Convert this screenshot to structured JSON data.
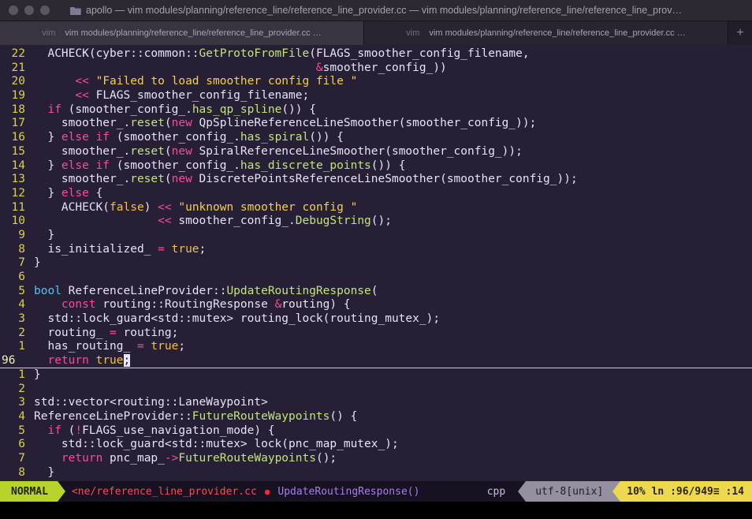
{
  "window": {
    "title": "apollo — vim modules/planning/reference_line/reference_line_provider.cc — vim modules/planning/reference_line/reference_line_prov…",
    "tabs": [
      {
        "process": "vim",
        "title": "vim modules/planning/reference_line/reference_line_provider.cc …"
      },
      {
        "process": "vim",
        "title": "vim modules/planning/reference_line/reference_line_provider.cc …"
      }
    ],
    "new_tab_label": "+"
  },
  "editor": {
    "lines": [
      {
        "num": "22",
        "current": false,
        "tokens": [
          {
            "c": "d",
            "t": "  ACHECK("
          },
          {
            "c": "d",
            "t": "cyber::common::"
          },
          {
            "c": "f",
            "t": "GetProtoFromFile"
          },
          {
            "c": "d",
            "t": "(FLAGS_smoother_config_filename,"
          }
        ]
      },
      {
        "num": "21",
        "current": false,
        "tokens": [
          {
            "c": "d",
            "t": "                                         "
          },
          {
            "c": "k",
            "t": "&"
          },
          {
            "c": "d",
            "t": "smoother_config_))"
          }
        ]
      },
      {
        "num": "20",
        "current": false,
        "tokens": [
          {
            "c": "d",
            "t": "      "
          },
          {
            "c": "k",
            "t": "<<"
          },
          {
            "c": "d",
            "t": " "
          },
          {
            "c": "s",
            "t": "\"Failed to load smoother config file \""
          }
        ]
      },
      {
        "num": "19",
        "current": false,
        "tokens": [
          {
            "c": "d",
            "t": "      "
          },
          {
            "c": "k",
            "t": "<<"
          },
          {
            "c": "d",
            "t": " FLAGS_smoother_config_filename;"
          }
        ]
      },
      {
        "num": "18",
        "current": false,
        "tokens": [
          {
            "c": "d",
            "t": "  "
          },
          {
            "c": "k",
            "t": "if"
          },
          {
            "c": "d",
            "t": " (smoother_config_."
          },
          {
            "c": "f",
            "t": "has_qp_spline"
          },
          {
            "c": "d",
            "t": "()) {"
          }
        ]
      },
      {
        "num": "17",
        "current": false,
        "tokens": [
          {
            "c": "d",
            "t": "    smoother_."
          },
          {
            "c": "f",
            "t": "reset"
          },
          {
            "c": "d",
            "t": "("
          },
          {
            "c": "k",
            "t": "new"
          },
          {
            "c": "d",
            "t": " QpSplineReferenceLineSmoother(smoother_config_));"
          }
        ]
      },
      {
        "num": "16",
        "current": false,
        "tokens": [
          {
            "c": "d",
            "t": "  } "
          },
          {
            "c": "k",
            "t": "else"
          },
          {
            "c": "d",
            "t": " "
          },
          {
            "c": "k",
            "t": "if"
          },
          {
            "c": "d",
            "t": " (smoother_config_."
          },
          {
            "c": "f",
            "t": "has_spiral"
          },
          {
            "c": "d",
            "t": "()) {"
          }
        ]
      },
      {
        "num": "15",
        "current": false,
        "tokens": [
          {
            "c": "d",
            "t": "    smoother_."
          },
          {
            "c": "f",
            "t": "reset"
          },
          {
            "c": "d",
            "t": "("
          },
          {
            "c": "k",
            "t": "new"
          },
          {
            "c": "d",
            "t": " SpiralReferenceLineSmoother(smoother_config_));"
          }
        ]
      },
      {
        "num": "14",
        "current": false,
        "tokens": [
          {
            "c": "d",
            "t": "  } "
          },
          {
            "c": "k",
            "t": "else"
          },
          {
            "c": "d",
            "t": " "
          },
          {
            "c": "k",
            "t": "if"
          },
          {
            "c": "d",
            "t": " (smoother_config_."
          },
          {
            "c": "f",
            "t": "has_discrete_points"
          },
          {
            "c": "d",
            "t": "()) {"
          }
        ]
      },
      {
        "num": "13",
        "current": false,
        "tokens": [
          {
            "c": "d",
            "t": "    smoother_."
          },
          {
            "c": "f",
            "t": "reset"
          },
          {
            "c": "d",
            "t": "("
          },
          {
            "c": "k",
            "t": "new"
          },
          {
            "c": "d",
            "t": " DiscretePointsReferenceLineSmoother(smoother_config_));"
          }
        ]
      },
      {
        "num": "12",
        "current": false,
        "tokens": [
          {
            "c": "d",
            "t": "  } "
          },
          {
            "c": "k",
            "t": "else"
          },
          {
            "c": "d",
            "t": " {"
          }
        ]
      },
      {
        "num": "11",
        "current": false,
        "tokens": [
          {
            "c": "d",
            "t": "    ACHECK("
          },
          {
            "c": "b",
            "t": "false"
          },
          {
            "c": "d",
            "t": ") "
          },
          {
            "c": "k",
            "t": "<<"
          },
          {
            "c": "d",
            "t": " "
          },
          {
            "c": "s",
            "t": "\"unknown smoother config \""
          }
        ]
      },
      {
        "num": "10",
        "current": false,
        "tokens": [
          {
            "c": "d",
            "t": "                  "
          },
          {
            "c": "k",
            "t": "<<"
          },
          {
            "c": "d",
            "t": " smoother_config_."
          },
          {
            "c": "f",
            "t": "DebugString"
          },
          {
            "c": "d",
            "t": "();"
          }
        ]
      },
      {
        "num": "9",
        "current": false,
        "tokens": [
          {
            "c": "d",
            "t": "  }"
          }
        ]
      },
      {
        "num": "8",
        "current": false,
        "tokens": [
          {
            "c": "d",
            "t": "  is_initialized_ "
          },
          {
            "c": "k",
            "t": "="
          },
          {
            "c": "d",
            "t": " "
          },
          {
            "c": "b",
            "t": "true"
          },
          {
            "c": "d",
            "t": ";"
          }
        ]
      },
      {
        "num": "7",
        "current": false,
        "tokens": [
          {
            "c": "d",
            "t": "}"
          }
        ]
      },
      {
        "num": "6",
        "current": false,
        "tokens": []
      },
      {
        "num": "5",
        "current": false,
        "tokens": [
          {
            "c": "t",
            "t": "bool"
          },
          {
            "c": "d",
            "t": " ReferenceLineProvider::"
          },
          {
            "c": "f",
            "t": "UpdateRoutingResponse"
          },
          {
            "c": "d",
            "t": "("
          }
        ]
      },
      {
        "num": "4",
        "current": false,
        "tokens": [
          {
            "c": "d",
            "t": "    "
          },
          {
            "c": "k",
            "t": "const"
          },
          {
            "c": "d",
            "t": " routing::RoutingResponse "
          },
          {
            "c": "k",
            "t": "&"
          },
          {
            "c": "d",
            "t": "routing) {"
          }
        ]
      },
      {
        "num": "3",
        "current": false,
        "tokens": [
          {
            "c": "d",
            "t": "  std::lock_guard<std::mutex> routing_lock(routing_mutex_);"
          }
        ]
      },
      {
        "num": "2",
        "current": false,
        "tokens": [
          {
            "c": "d",
            "t": "  routing_ "
          },
          {
            "c": "k",
            "t": "="
          },
          {
            "c": "d",
            "t": " routing;"
          }
        ]
      },
      {
        "num": "1",
        "current": false,
        "tokens": [
          {
            "c": "d",
            "t": "  has_routing_ "
          },
          {
            "c": "k",
            "t": "="
          },
          {
            "c": "d",
            "t": " "
          },
          {
            "c": "b",
            "t": "true"
          },
          {
            "c": "d",
            "t": ";"
          }
        ]
      },
      {
        "num": "96",
        "current": true,
        "tokens": [
          {
            "c": "d",
            "t": "  "
          },
          {
            "c": "k",
            "t": "return"
          },
          {
            "c": "d",
            "t": " "
          },
          {
            "c": "b",
            "t": "true"
          },
          {
            "c": "c",
            "t": ";"
          }
        ]
      },
      {
        "num": "1",
        "current": false,
        "tokens": [
          {
            "c": "d",
            "t": "}"
          }
        ]
      },
      {
        "num": "2",
        "current": false,
        "tokens": []
      },
      {
        "num": "3",
        "current": false,
        "tokens": [
          {
            "c": "d",
            "t": "std::vector<routing::LaneWaypoint>"
          }
        ]
      },
      {
        "num": "4",
        "current": false,
        "tokens": [
          {
            "c": "d",
            "t": "ReferenceLineProvider::"
          },
          {
            "c": "f",
            "t": "FutureRouteWaypoints"
          },
          {
            "c": "d",
            "t": "() {"
          }
        ]
      },
      {
        "num": "5",
        "current": false,
        "tokens": [
          {
            "c": "d",
            "t": "  "
          },
          {
            "c": "k",
            "t": "if"
          },
          {
            "c": "d",
            "t": " ("
          },
          {
            "c": "k",
            "t": "!"
          },
          {
            "c": "d",
            "t": "FLAGS_use_navigation_mode) {"
          }
        ]
      },
      {
        "num": "6",
        "current": false,
        "tokens": [
          {
            "c": "d",
            "t": "    std::lock_guard<std::mutex> lock(pnc_map_mutex_);"
          }
        ]
      },
      {
        "num": "7",
        "current": false,
        "tokens": [
          {
            "c": "d",
            "t": "    "
          },
          {
            "c": "k",
            "t": "return"
          },
          {
            "c": "d",
            "t": " pnc_map_"
          },
          {
            "c": "k",
            "t": "->"
          },
          {
            "c": "f",
            "t": "FutureRouteWaypoints"
          },
          {
            "c": "d",
            "t": "();"
          }
        ]
      },
      {
        "num": "8",
        "current": false,
        "tokens": [
          {
            "c": "d",
            "t": "  }"
          }
        ]
      }
    ]
  },
  "statusline": {
    "mode": "NORMAL",
    "file": "<ne/reference_line_provider.cc",
    "modified_indicator": "●",
    "function": "UpdateRoutingResponse()",
    "filetype": "cpp",
    "encoding": "utf-8[unix]",
    "position": "10% ln :96/949≡ :14"
  },
  "colors": {
    "bg": "#261f35",
    "fg": "#e8e2f6",
    "kw": "#fb4a9f",
    "str": "#f3d04e",
    "bool": "#f3c243",
    "type": "#4fc4f5",
    "fn": "#bfe57e",
    "lnum": "#d8d24e",
    "lnumCur": "#f2f0b6",
    "cursorBg": "#ece6fa",
    "underline": "#cfc8e4",
    "titlebarBg": "#2c2933",
    "titleFg": "#a5a1ad",
    "trafficFg": "#5b565f",
    "tabbarBg": "#211e29",
    "tabActiveBg": "#39343f",
    "tabInactiveBg": "#282430",
    "tabProcFg": "#76717f",
    "tabTitleFg": "#a9a4b4",
    "modeBg": "#b8d42c",
    "modeFg": "#20230e",
    "statusBg": "#171221",
    "fileFg": "#fb4b58",
    "dotFg": "#f4283d",
    "funcFg": "#a97ee8",
    "ftFg": "#c9bfe0",
    "encBg": "#94909f",
    "encFg": "#211d2b",
    "posBg": "#eed94e",
    "posFg": "#2a2410"
  }
}
